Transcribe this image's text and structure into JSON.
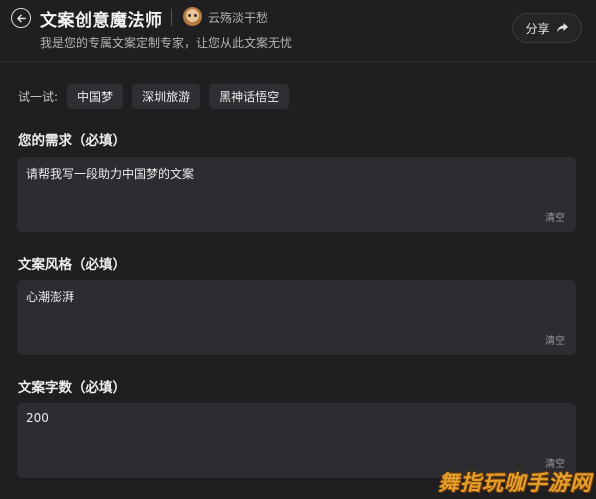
{
  "header": {
    "title": "文案创意魔法师",
    "author": "云殇淡干愁",
    "subtitle": "我是您的专属文案定制专家，让您从此文案无忧",
    "share_label": "分享"
  },
  "try": {
    "label": "试一试:",
    "chips": [
      "中国梦",
      "深圳旅游",
      "黑神话悟空"
    ]
  },
  "fields": [
    {
      "label": "您的需求（必填）",
      "value": "请帮我写一段助力中国梦的文案",
      "clear_label": "清空"
    },
    {
      "label": "文案风格（必填）",
      "value": "心潮澎湃",
      "clear_label": "清空"
    },
    {
      "label": "文案字数（必填）",
      "value": "200",
      "clear_label": "清空"
    }
  ],
  "watermark": "舞指玩咖手游网"
}
